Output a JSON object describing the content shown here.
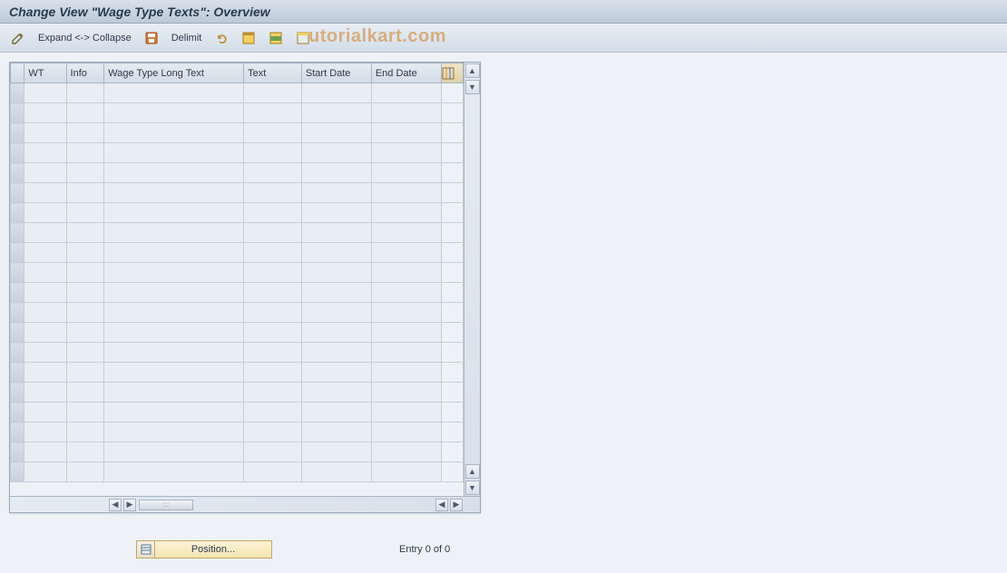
{
  "header": {
    "title": "Change View \"Wage Type Texts\": Overview"
  },
  "toolbar": {
    "expand_collapse": "Expand <-> Collapse",
    "delimit": "Delimit",
    "icons": {
      "pencil": "change-icon",
      "save": "save-icon",
      "undo": "undo-icon",
      "select_all": "select-all-icon",
      "select_block": "select-block-icon",
      "deselect": "deselect-all-icon"
    }
  },
  "watermark": "utorialkart.com",
  "table": {
    "columns": [
      "WT",
      "Info",
      "Wage Type Long Text",
      "Text",
      "Start Date",
      "End Date"
    ],
    "rows": 20
  },
  "footer": {
    "position_label": "Position...",
    "entry_text": "Entry 0 of 0"
  }
}
